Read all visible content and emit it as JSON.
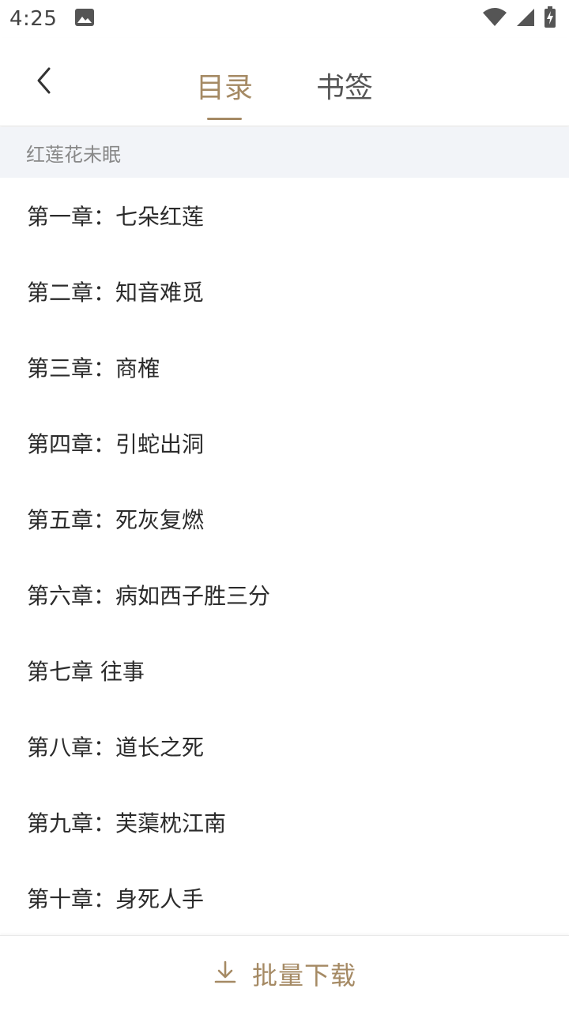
{
  "status_bar": {
    "time": "4:25",
    "icons": [
      "image-notification-icon",
      "wifi-icon",
      "cell-signal-icon",
      "battery-charging-icon"
    ]
  },
  "header": {
    "back_icon": "chevron-left-icon",
    "tabs": [
      {
        "label": "目录",
        "active": true
      },
      {
        "label": "书签",
        "active": false
      }
    ]
  },
  "book": {
    "title": "红莲花未眠"
  },
  "chapters": [
    "第一章：七朵红莲",
    "第二章：知音难觅",
    "第三章：商榷",
    "第四章：引蛇出洞",
    "第五章：死灰复燃",
    "第六章：病如西子胜三分",
    "第七章 往事",
    "第八章：道长之死",
    "第九章：芙蕖枕江南",
    "第十章：身死人手"
  ],
  "bottom": {
    "icon": "download-icon",
    "label": "批量下载"
  },
  "colors": {
    "accent": "#a58a64",
    "text": "#2b2b2b",
    "section_bg": "#f2f4f8"
  }
}
